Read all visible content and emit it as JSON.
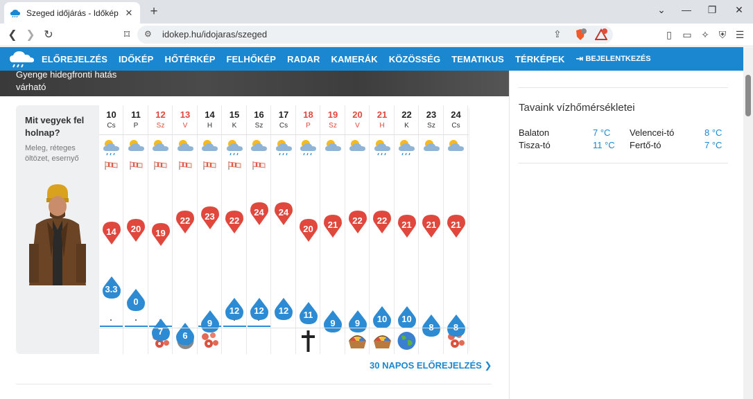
{
  "browser": {
    "tab_title": "Szeged időjárás - Időkép",
    "url": "idokep.hu/idojaras/szeged"
  },
  "nav": {
    "items": [
      "ELŐREJELZÉS",
      "IDŐKÉP",
      "HŐTÉRKÉP",
      "FELHŐKÉP",
      "RADAR",
      "KAMERÁK",
      "KÖZÖSSÉG",
      "TEMATIKUS",
      "TÉRKÉPEK"
    ],
    "login": "BEJELENTKEZÉS"
  },
  "hero": {
    "text": "Gyenge hidegfronti hatás várható"
  },
  "clothing": {
    "title": "Mit vegyek fel holnap?",
    "desc": "Meleg, réteges öltözet, esernyő"
  },
  "days": [
    {
      "num": "10",
      "name": "Cs",
      "red": false,
      "max": null,
      "min": "14",
      "precip": "3.3"
    },
    {
      "num": "11",
      "name": "P",
      "red": false,
      "max": "20",
      "min": null,
      "precip": "0"
    },
    {
      "num": "12",
      "name": "Sz",
      "red": true,
      "max": "19",
      "min": "7",
      "precip": null
    },
    {
      "num": "13",
      "name": "V",
      "red": true,
      "max": "22",
      "min": "6",
      "precip": null
    },
    {
      "num": "14",
      "name": "H",
      "red": false,
      "max": "23",
      "min": "9",
      "precip": null
    },
    {
      "num": "15",
      "name": "K",
      "red": false,
      "max": "22",
      "min": "12",
      "precip": null
    },
    {
      "num": "16",
      "name": "Sz",
      "red": false,
      "max": "24",
      "min": "12",
      "precip": null
    },
    {
      "num": "17",
      "name": "Cs",
      "red": false,
      "max": "24",
      "min": "12",
      "precip": null
    },
    {
      "num": "18",
      "name": "P",
      "red": true,
      "max": "20",
      "min": "11",
      "precip": null
    },
    {
      "num": "19",
      "name": "Sz",
      "red": true,
      "max": "21",
      "min": "9",
      "precip": null
    },
    {
      "num": "20",
      "name": "V",
      "red": true,
      "max": "22",
      "min": "9",
      "precip": null
    },
    {
      "num": "21",
      "name": "H",
      "red": true,
      "max": "22",
      "min": "10",
      "precip": null
    },
    {
      "num": "22",
      "name": "K",
      "red": false,
      "max": "21",
      "min": "10",
      "precip": null
    },
    {
      "num": "23",
      "name": "Sz",
      "red": false,
      "max": "21",
      "min": "8",
      "precip": null
    },
    {
      "num": "24",
      "name": "Cs",
      "red": false,
      "max": "21",
      "min": "8",
      "precip": null
    }
  ],
  "more_link": "30 NAPOS ELŐREJELZÉS",
  "sidebar": {
    "title": "Tavaink vízhőmérsékletei",
    "lakes": [
      {
        "name": "Balaton",
        "temp": "7 °C"
      },
      {
        "name": "Velencei-tó",
        "temp": "8 °C"
      },
      {
        "name": "Tisza-tó",
        "temp": "11 °C"
      },
      {
        "name": "Fertő-tó",
        "temp": "7 °C"
      }
    ]
  },
  "colors": {
    "brand": "#1a87d0",
    "max_pin": "#e0483e",
    "min_pin": "#2d8bd3"
  }
}
